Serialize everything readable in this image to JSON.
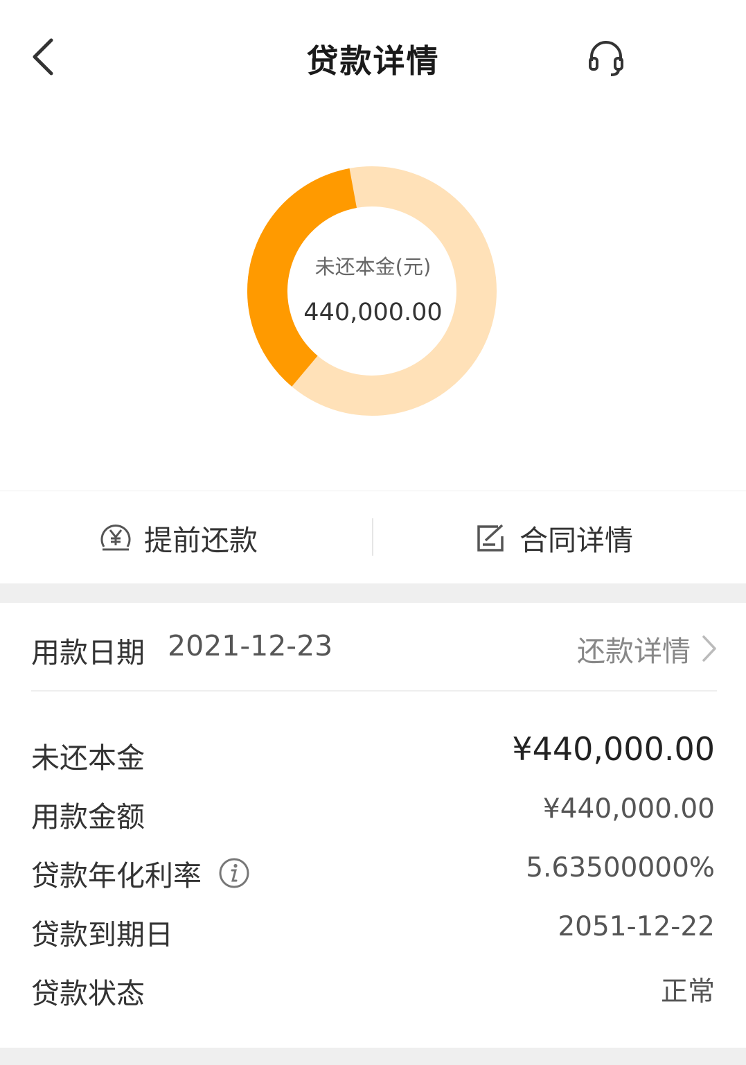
{
  "header": {
    "title": "贷款详情",
    "back_icon": "back-chevron-icon",
    "service_icon": "headset-icon"
  },
  "summary": {
    "label": "未还本金(元)",
    "value": "440,000.00",
    "chart": {
      "remaining_fraction": 0.36,
      "accent": "#FF9A00",
      "track": "#FFE1B8"
    }
  },
  "actions": {
    "prepay_label": "提前还款",
    "contract_label": "合同详情"
  },
  "loan": {
    "date_label": "用款日期",
    "date_value": "2021-12-23",
    "repay_link": "还款详情",
    "rows": [
      {
        "label": "未还本金",
        "value": "¥440,000.00"
      },
      {
        "label": "用款金额",
        "value": "¥440,000.00"
      },
      {
        "label": "贷款年化利率",
        "value": "5.63500000%"
      },
      {
        "label": "贷款到期日",
        "value": "2051-12-22"
      },
      {
        "label": "贷款状态",
        "value": "正常"
      }
    ]
  }
}
